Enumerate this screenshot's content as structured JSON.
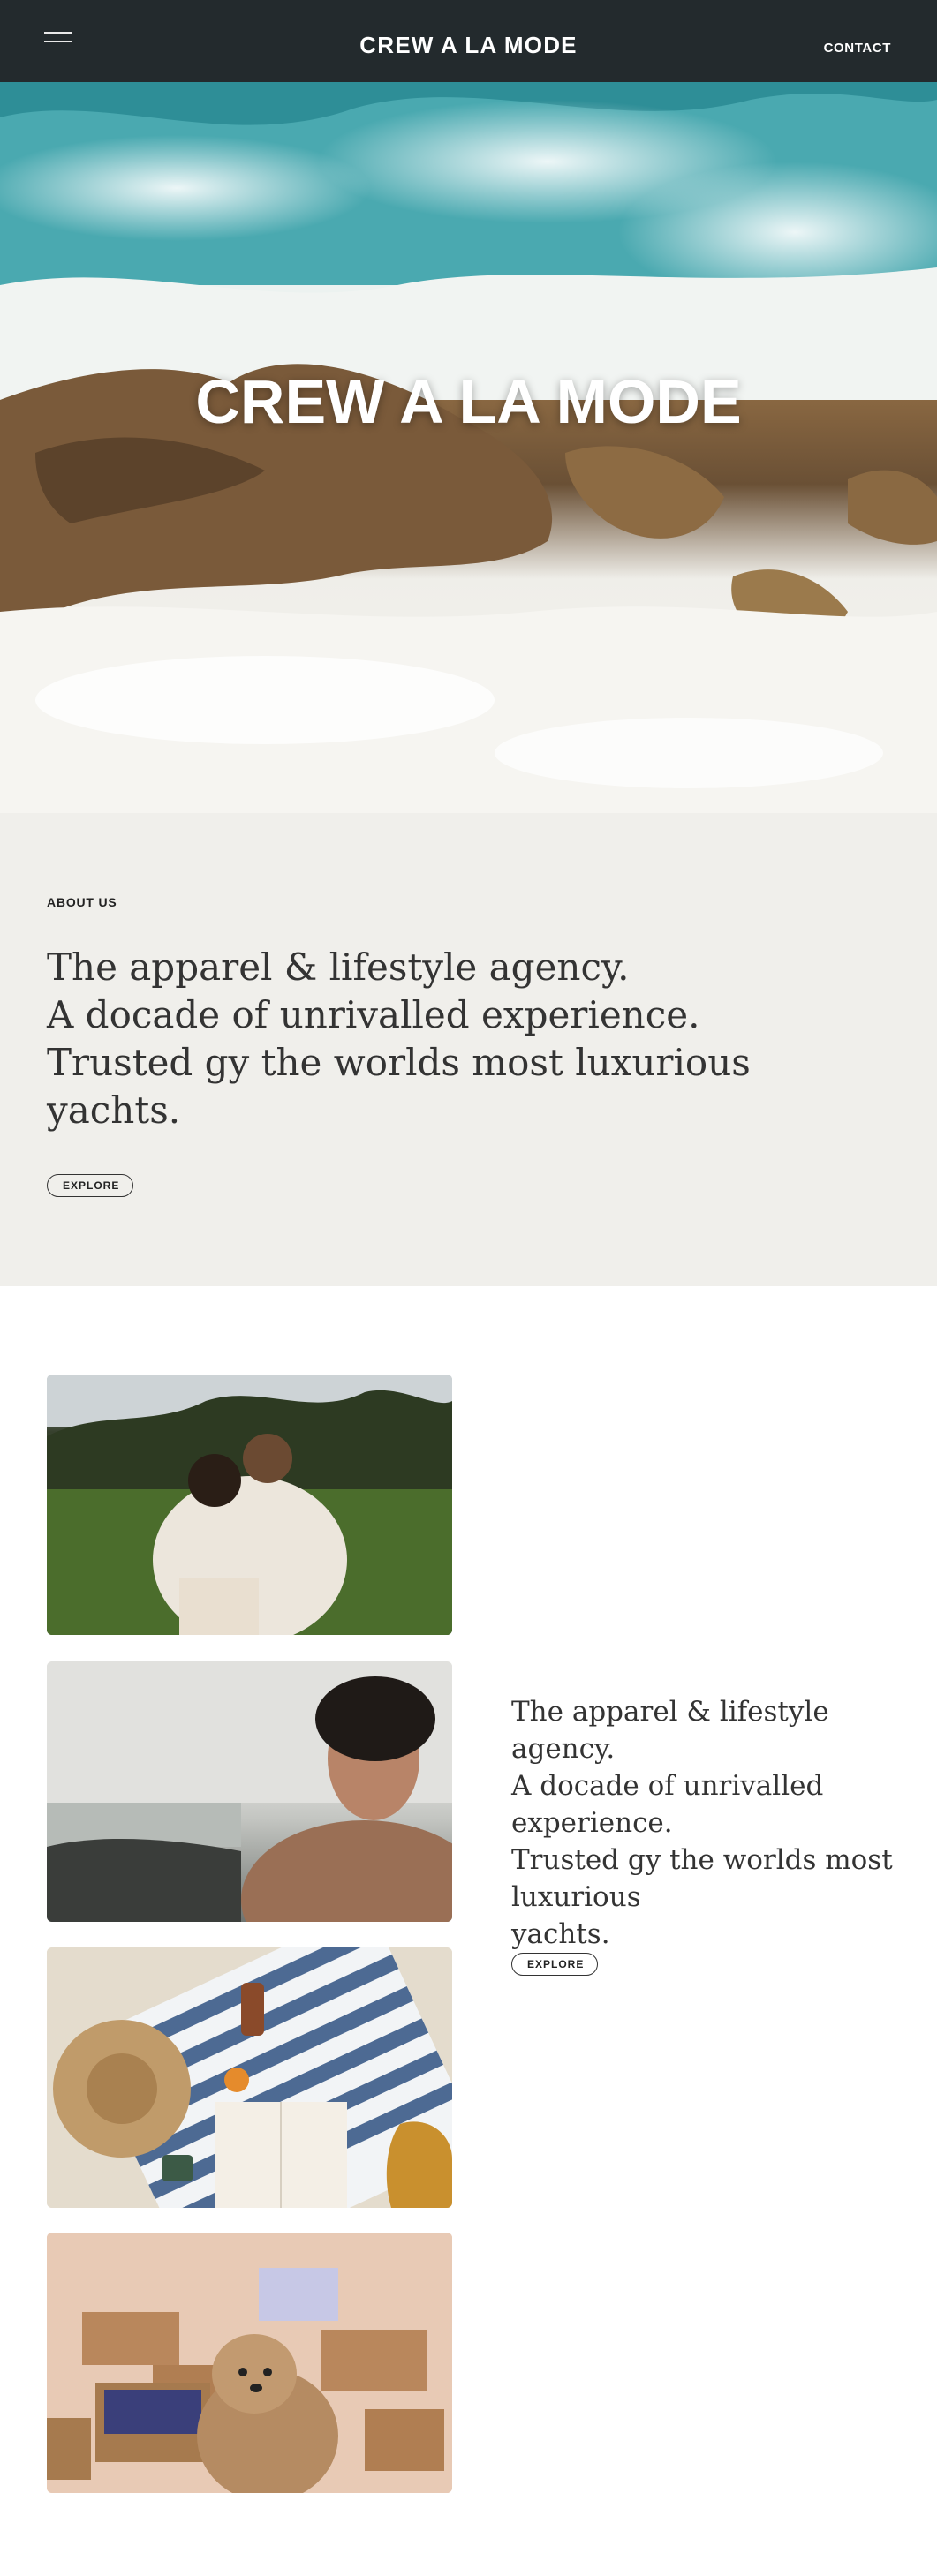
{
  "header": {
    "brand": "CREW A LA MODE",
    "contact_label": "CONTACT"
  },
  "hero": {
    "title": "CREW A LA MODE"
  },
  "about": {
    "label": "ABOUT US",
    "lines": [
      "The apparel & lifestyle agency.",
      "A docade of unrivalled experience.",
      "Trusted gy the worlds most luxurious",
      "yachts."
    ],
    "button_label": "EXPLORE"
  },
  "gallery": {
    "side_lines": [
      "The apparel & lifestyle agency.",
      "A docade of unrivalled",
      "experience.",
      "Trusted gy the worlds most",
      "luxurious",
      "yachts."
    ],
    "button_label": "EXPLORE"
  },
  "colors": {
    "header_bg": "#232a2d",
    "about_bg": "#f0efeb",
    "page_bg": "#ffffff"
  }
}
